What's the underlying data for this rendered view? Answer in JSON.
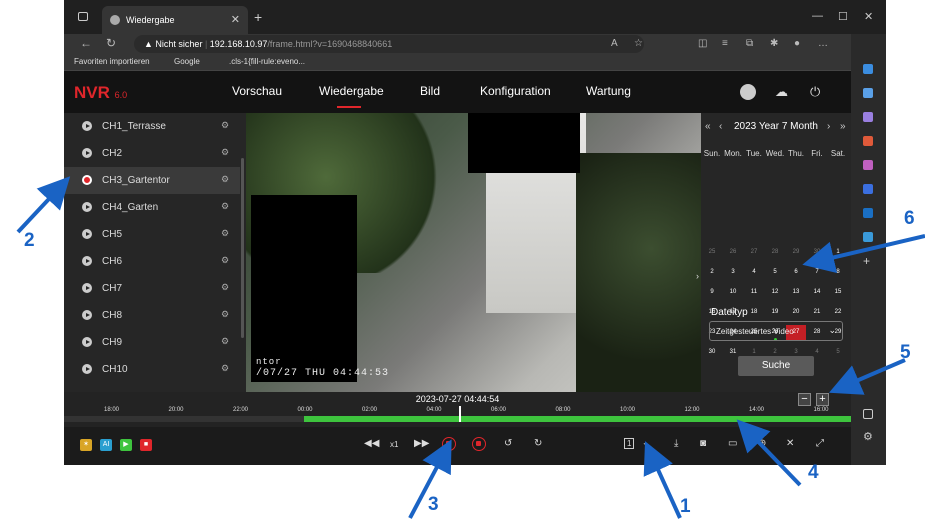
{
  "browser": {
    "tab_title": "Wiedergabe",
    "address_warning": "Nicht sicher",
    "address_host": "192.168.10.97",
    "address_path": "/frame.html?v=1690468840661",
    "bookmarks": [
      "Favoriten importieren",
      "Google",
      ".cls-1{fill-rule:eveno..."
    ]
  },
  "app": {
    "logo": "NVR",
    "logo_version": "6.0",
    "menu": [
      "Vorschau",
      "Wiedergabe",
      "Bild",
      "Konfiguration",
      "Wartung"
    ],
    "active_menu": "Wiedergabe"
  },
  "channels": [
    {
      "label": "CH1_Terrasse"
    },
    {
      "label": "CH2"
    },
    {
      "label": "CH3_Gartentor",
      "selected": true
    },
    {
      "label": "CH4_Garten"
    },
    {
      "label": "CH5"
    },
    {
      "label": "CH6"
    },
    {
      "label": "CH7"
    },
    {
      "label": "CH8"
    },
    {
      "label": "CH9"
    },
    {
      "label": "CH10"
    }
  ],
  "video": {
    "osd_name": "ntor",
    "osd_datetime": "/07/27 THU 04:44:53"
  },
  "calendar": {
    "year_label": "2023 Year",
    "month_label": "7 Month",
    "weekdays": [
      "Sun.",
      "Mon.",
      "Tue.",
      "Wed.",
      "Thu.",
      "Fri.",
      "Sat."
    ],
    "weeks": [
      [
        "25",
        "26",
        "27",
        "28",
        "29",
        "30",
        "1"
      ],
      [
        "2",
        "3",
        "4",
        "5",
        "6",
        "7",
        "8"
      ],
      [
        "9",
        "10",
        "11",
        "12",
        "13",
        "14",
        "15"
      ],
      [
        "16",
        "17",
        "18",
        "19",
        "20",
        "21",
        "22"
      ],
      [
        "23",
        "24",
        "25",
        "26",
        "27",
        "28",
        "29"
      ],
      [
        "30",
        "31",
        "1",
        "2",
        "3",
        "4",
        "5"
      ]
    ],
    "selected_day": "27",
    "dateityp_label": "Dateityp",
    "dateityp_value": "Zeitgesteuertes Video",
    "search_label": "Suche"
  },
  "timeline": {
    "current_time": "2023-07-27 04:44:54",
    "ticks": [
      "18:00",
      "20:00",
      "22:00",
      "00:00",
      "02:00",
      "04:00",
      "06:00",
      "08:00",
      "10:00",
      "12:00",
      "14:00",
      "16:00"
    ],
    "zoom_minus": "−",
    "zoom_plus": "+"
  },
  "controls": {
    "speed": "x1"
  },
  "annotations": [
    "1",
    "2",
    "3",
    "4",
    "5",
    "6"
  ],
  "colors": {
    "brand_red": "#e0262b",
    "annotation_blue": "#1a63c4",
    "recording_green": "#3ec43e"
  }
}
